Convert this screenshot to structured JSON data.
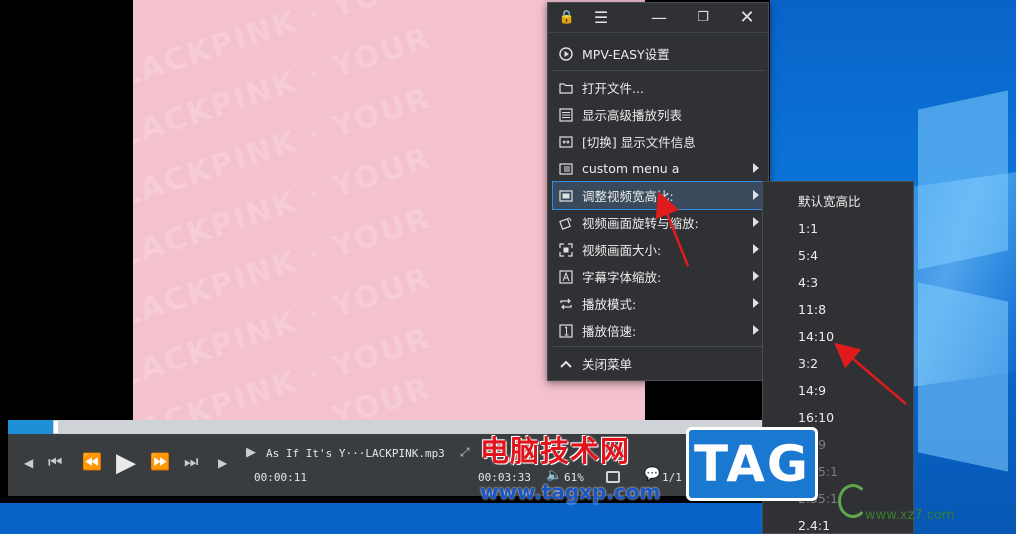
{
  "video": {
    "watermark_lines": [
      "LACKPINK · YOUR",
      "LACKPINK · YOUR",
      "LACKPINK · YOUR",
      "LACKPINK · YOUR",
      "LACKPINK · YOUR",
      "LACKPINK · YOUR",
      "LACKPINK · YOUR",
      "LACKPINK · YOUR"
    ]
  },
  "player": {
    "file_title": "As  If  It's  Y···LACKPINK.mp3",
    "elapsed": "00:00:11",
    "duration": "00:03:33",
    "volume": "61%",
    "playlist_pos": "1/1",
    "progress_fraction": 0.06
  },
  "menu": {
    "title": "MPV-EASY设置",
    "items": [
      {
        "label": "打开文件...",
        "icon": "folder-icon",
        "submenu": false
      },
      {
        "label": "显示高级播放列表",
        "icon": "list-icon",
        "submenu": false
      },
      {
        "label": "[切换] 显示文件信息",
        "icon": "info-toggle-icon",
        "submenu": false
      },
      {
        "label": "custom menu a",
        "icon": "custom-menu-icon",
        "submenu": true
      },
      {
        "label": "调整视频宽高比:",
        "icon": "aspect-ratio-icon",
        "submenu": true
      },
      {
        "label": "视频画面旋转与缩放:",
        "icon": "rotate-icon",
        "submenu": true
      },
      {
        "label": "视频画面大小:",
        "icon": "resize-icon",
        "submenu": true
      },
      {
        "label": "字幕字体缩放:",
        "icon": "font-scale-icon",
        "submenu": true
      },
      {
        "label": "播放模式:",
        "icon": "repeat-icon",
        "submenu": true
      },
      {
        "label": "播放倍速:",
        "icon": "speed-icon",
        "submenu": true
      }
    ],
    "close_label": "关闭菜单"
  },
  "submenu": {
    "items": [
      "默认宽高比",
      "1:1",
      "5:4",
      "4:3",
      "11:8",
      "14:10",
      "3:2",
      "14:9",
      "16:10",
      "16:9",
      "1.85:1",
      "2.35:1",
      "2.4:1"
    ]
  },
  "overlay": {
    "site_title": "电脑技术网",
    "site_url": "www.tagxp.com",
    "tag_logo": "TAG",
    "corner_url": "www.xz7.com"
  },
  "colors": {
    "menu_bg": "#2f3134",
    "accent": "#2c8ee8",
    "video_bg": "#f4c1cf",
    "arrow": "#e01b1b"
  }
}
